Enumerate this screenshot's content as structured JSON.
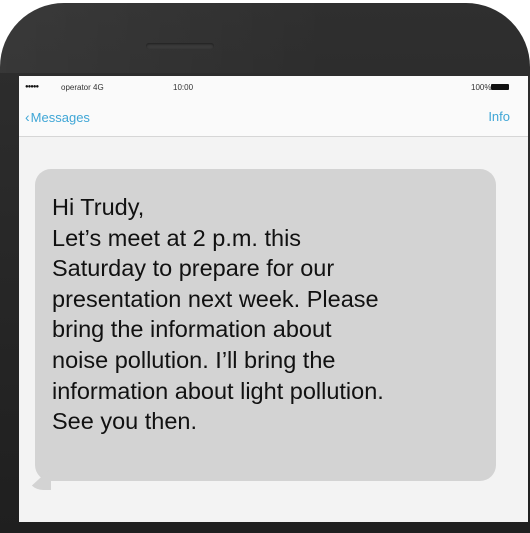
{
  "status_bar": {
    "signal": "●●●●●",
    "carrier": "operator 4G",
    "time": "10:00",
    "battery": "100%"
  },
  "nav": {
    "back_label": "Messages",
    "info_label": "Info"
  },
  "message": {
    "text": "Hi Trudy,\nLet’s meet at 2 p.m. this\nSaturday to prepare for our\npresentation next week. Please\nbring the information about\nnoise pollution. I’ll bring the\ninformation about light pollution.\nSee you then."
  }
}
